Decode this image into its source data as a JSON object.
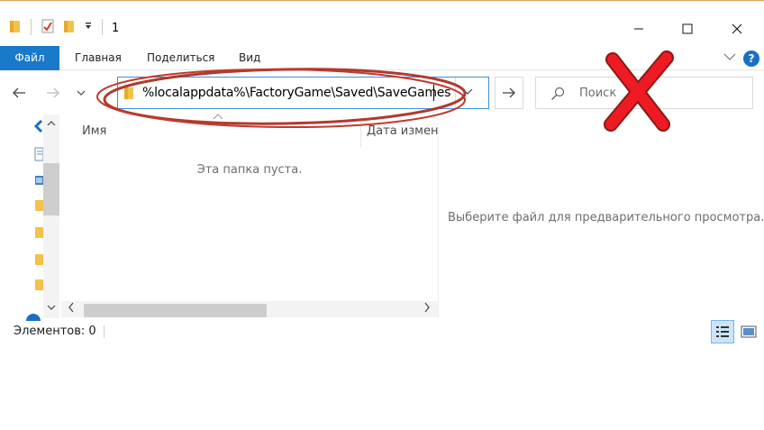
{
  "window": {
    "title": "1",
    "quick_access": [
      "folder-icon",
      "properties-icon",
      "new-folder-icon",
      "customize-dropdown"
    ]
  },
  "ribbon": {
    "tabs": [
      "Файл",
      "Главная",
      "Поделиться",
      "Вид"
    ],
    "active_tab": "Файл",
    "help": "?"
  },
  "address": {
    "path": "%localappdata%\\FactoryGame\\Saved\\SaveGames"
  },
  "search": {
    "placeholder": "Поиск"
  },
  "file_list": {
    "columns": [
      "Имя",
      "Дата измен"
    ],
    "empty_message": "Эта папка пуста."
  },
  "preview": {
    "message": "Выберите файл для предварительного просмотра."
  },
  "status_bar": {
    "item_count": "Элементов: 0",
    "active_view": "details"
  },
  "colors": {
    "accent": "#1979ca",
    "annotation": "#c0392b",
    "x_mark": "#e8141c"
  }
}
